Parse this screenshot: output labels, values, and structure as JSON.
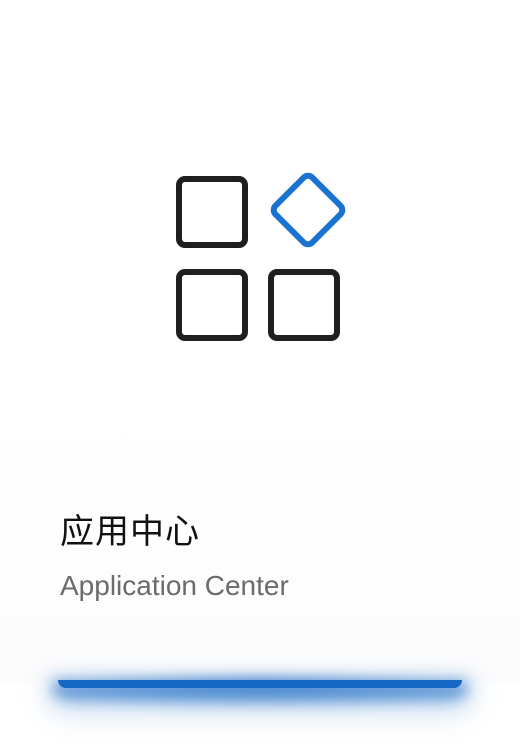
{
  "tile": {
    "title": "应用中心",
    "subtitle": "Application Center",
    "icon": "app-grid-icon"
  },
  "colors": {
    "accent": "#1668c4",
    "icon_stroke": "#1f1f1f",
    "title_text": "#111111",
    "subtitle_text": "#6b6b6b",
    "background": "#ffffff"
  }
}
